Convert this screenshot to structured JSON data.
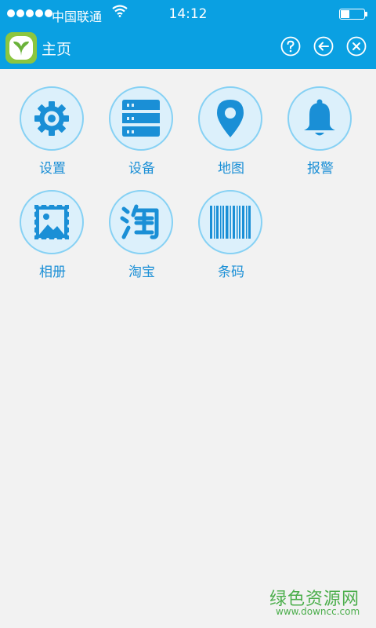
{
  "status": {
    "carrier": "中国联通",
    "time": "14:12"
  },
  "header": {
    "title": "主页",
    "buttons": [
      "help-icon",
      "back-icon",
      "close-icon"
    ]
  },
  "menu": {
    "items": [
      {
        "label": "设置",
        "icon": "gear-icon"
      },
      {
        "label": "设备",
        "icon": "server-icon"
      },
      {
        "label": "地图",
        "icon": "map-pin-icon"
      },
      {
        "label": "报警",
        "icon": "bell-icon"
      },
      {
        "label": "相册",
        "icon": "photo-album-icon"
      },
      {
        "label": "淘宝",
        "icon": "taobao-icon"
      },
      {
        "label": "条码",
        "icon": "barcode-icon"
      }
    ]
  },
  "watermark": {
    "name": "绿色资源网",
    "url": "www.downcc.com"
  },
  "colors": {
    "primary": "#0aa0e2",
    "icon": "#1a8fd6",
    "circle_bg": "#dcf0fb",
    "background": "#f2f2f2"
  }
}
